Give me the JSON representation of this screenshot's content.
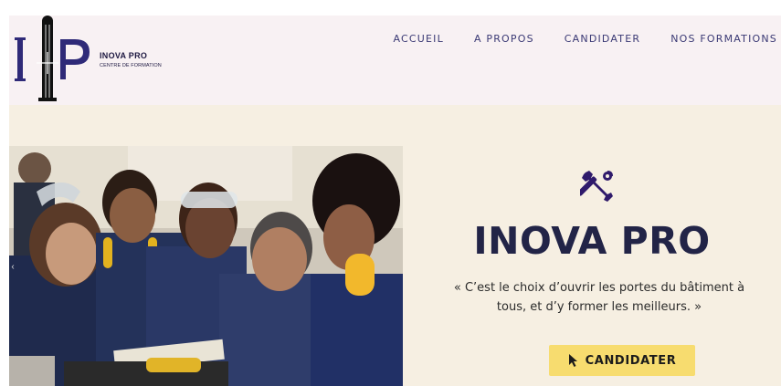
{
  "brand": {
    "name": "INOVA PRO",
    "tagline": "CENTRE DE FORMATION",
    "logo_letters": "IP"
  },
  "nav": {
    "items": [
      {
        "label": "ACCUEIL"
      },
      {
        "label": "A PROPOS"
      },
      {
        "label": "CANDIDATER"
      },
      {
        "label": "NOS FORMATIONS"
      }
    ]
  },
  "hero": {
    "icon": "tools-icon",
    "title": "INOVA PRO",
    "quote": "« C’est le choix d’ouvrir les portes du bâtiment à tous, et d’y former les meilleurs. »",
    "cta_label": "CANDIDATER",
    "cta_icon": "cursor-icon",
    "slider_arrow": "‹"
  },
  "colors": {
    "header_bg": "#f8f1f3",
    "hero_bg": "#f6efe2",
    "brand_navy": "#222447",
    "icon_purple": "#2f1a6b",
    "cta_yellow": "#f7dc6f"
  }
}
